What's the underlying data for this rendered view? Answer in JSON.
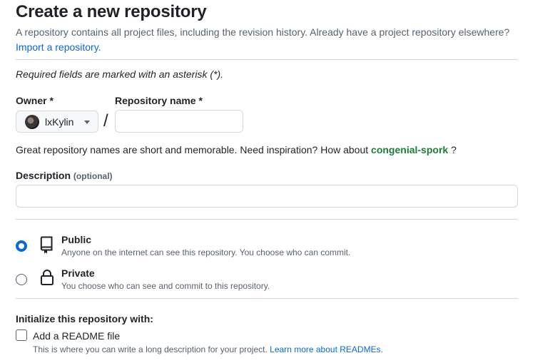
{
  "header": {
    "title": "Create a new repository",
    "intro_text": "A repository contains all project files, including the revision history. Already have a project repository elsewhere?",
    "import_link": "Import a repository."
  },
  "required_note": "Required fields are marked with an asterisk (*).",
  "owner": {
    "label": "Owner *",
    "value": "lxKylin",
    "icon": "chevron-down-icon"
  },
  "separator": "/",
  "repo_name": {
    "label": "Repository name *",
    "value": "",
    "placeholder": ""
  },
  "name_hint": {
    "text": "Great repository names are short and memorable. Need inspiration? How about",
    "suggestion": "congenial-spork",
    "trailing": "?"
  },
  "description": {
    "label": "Description",
    "optional": "(optional)",
    "value": "",
    "placeholder": ""
  },
  "visibility": {
    "options": [
      {
        "title": "Public",
        "desc": "Anyone on the internet can see this repository. You choose who can commit.",
        "selected": true,
        "icon": "repo-icon"
      },
      {
        "title": "Private",
        "desc": "You choose who can see and commit to this repository.",
        "selected": false,
        "icon": "lock-icon"
      }
    ]
  },
  "init": {
    "heading": "Initialize this repository with:",
    "readme_label": "Add a README file",
    "readme_checked": false,
    "readme_desc": "This is where you can write a long description for your project.",
    "readme_link": "Learn more about READMEs."
  },
  "colors": {
    "accent": "#0969da",
    "suggestion": "#1a7f37",
    "muted": "#59636e",
    "border": "#d1d9e0"
  }
}
